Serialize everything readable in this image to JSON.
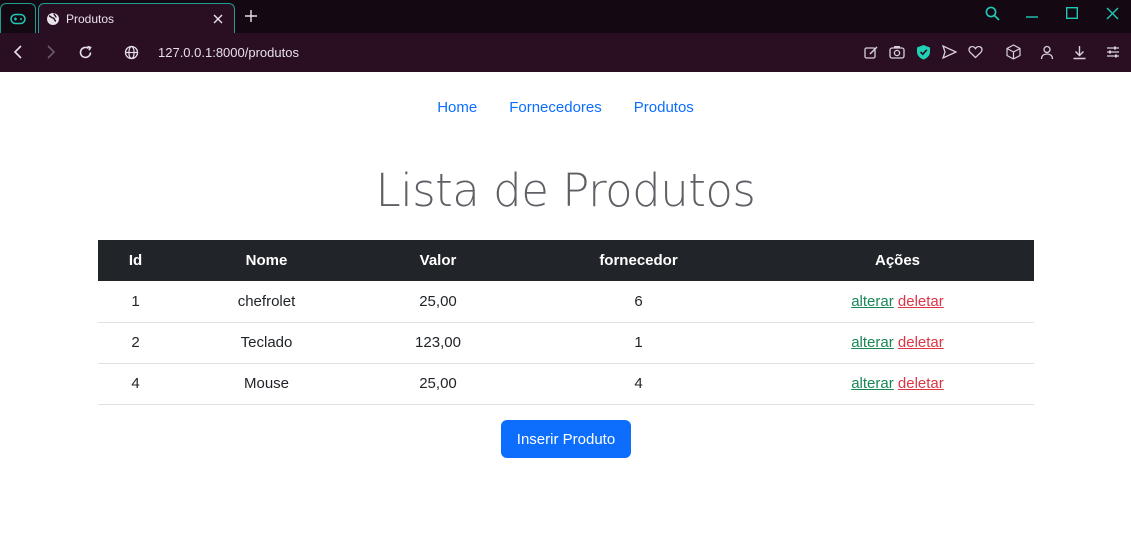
{
  "browser": {
    "tab_title": "Produtos",
    "url": "127.0.0.1:8000/produtos"
  },
  "nav": {
    "links": [
      "Home",
      "Fornecedores",
      "Produtos"
    ]
  },
  "page": {
    "title": "Lista de Produtos",
    "insert_button": "Inserir Produto"
  },
  "table": {
    "headers": [
      "Id",
      "Nome",
      "Valor",
      "fornecedor",
      "Ações"
    ],
    "rows": [
      {
        "id": "1",
        "nome": "chefrolet",
        "valor": "25,00",
        "fornecedor": "6",
        "alterar": "alterar",
        "deletar": "deletar"
      },
      {
        "id": "2",
        "nome": "Teclado",
        "valor": "123,00",
        "fornecedor": "1",
        "alterar": "alterar",
        "deletar": "deletar"
      },
      {
        "id": "4",
        "nome": "Mouse",
        "valor": "25,00",
        "fornecedor": "4",
        "alterar": "alterar",
        "deletar": "deletar"
      }
    ]
  },
  "colors": {
    "link": "#0d6efd",
    "header_bg": "#212529",
    "edit": "#198754",
    "delete": "#dc3545",
    "chrome_bg": "#2a0f22",
    "chrome_accent": "#1f9d8f"
  }
}
